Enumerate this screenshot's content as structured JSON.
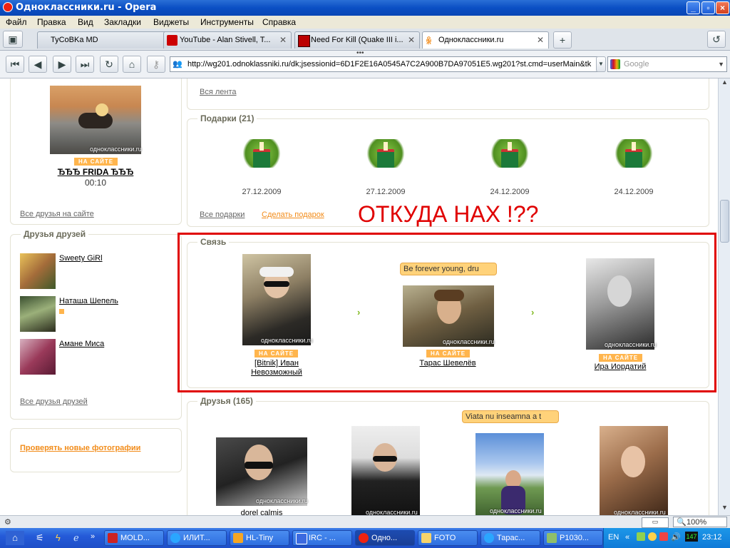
{
  "window": {
    "title": "Одноклассники.ru - Opera"
  },
  "menu": [
    "Файл",
    "Правка",
    "Вид",
    "Закладки",
    "Виджеты",
    "Инструменты",
    "Справка"
  ],
  "tabs": [
    {
      "label": "TyCoBKa MD"
    },
    {
      "label": "YouTube - Alan Stivell, T..."
    },
    {
      "label": "Need For Kill (Quake III i..."
    },
    {
      "label": "Одноклассники.ru"
    }
  ],
  "address": {
    "url": "http://wg201.odnoklassniki.ru/dk;jsessionid=6D1F2E16A0545A7C2A900B7DA97051E5.wg201?st.cmd=userMain&tk",
    "search_placeholder": "Google"
  },
  "left": {
    "friend_online": {
      "name": "ЂЂЂ FRIDA ЂЂЂ",
      "time": "00:10",
      "badge": "НА САЙТЕ",
      "watermark": "одноклассники.ru"
    },
    "all_friends_online": "Все друзья на сайте",
    "friends_of_friends": {
      "title": "Друзья друзей",
      "items": [
        {
          "name": "Sweety GiRl"
        },
        {
          "name": "Наташа Шепель"
        },
        {
          "name": "Амане Миса"
        }
      ],
      "all_link": "Все друзья друзей"
    },
    "check_photos": "Проверять новые фотографии"
  },
  "main": {
    "feed_link": "Вся лента",
    "gifts": {
      "title": "Подарки (21)",
      "dates": [
        "27.12.2009",
        "27.12.2009",
        "24.12.2009",
        "24.12.2009"
      ],
      "all_link": "Все подарки",
      "make_link": "Сделать подарок"
    },
    "annotation": "ОТКУДА НАХ !??",
    "connection": {
      "title": "Связь",
      "people": [
        {
          "name_line1": "[Bitnik] Иван",
          "name_line2": "Невозможный",
          "badge": "НА САЙТЕ"
        },
        {
          "name_line1": "Тарас Шевелёв",
          "name_line2": "",
          "badge": "НА САЙТЕ",
          "bubble": "Be forever young, dru"
        },
        {
          "name_line1": "Ира Иордатий",
          "name_line2": "",
          "badge": "НА САЙТЕ"
        }
      ]
    },
    "friends": {
      "title": "Друзья (165)",
      "people": [
        {
          "name": "dorel calmis"
        },
        {
          "name": ""
        },
        {
          "name": "",
          "bubble": "Viata nu inseamna a t"
        },
        {
          "name": ""
        }
      ]
    },
    "watermark": "одноклассники.ru"
  },
  "status": {
    "zoom": "100%"
  },
  "taskbar": {
    "items": [
      "MOLD...",
      "ИЛИТ...",
      "HL-Tiny",
      "IRC - ...",
      "Одно...",
      "FOTO",
      "Тарас...",
      "P1030..."
    ],
    "lang": "EN",
    "clock": "23:12",
    "tray_num": "147"
  },
  "colors": {
    "accent": "#f28c1a",
    "badge": "#ffb54d",
    "annotation_red": "#e00000"
  }
}
